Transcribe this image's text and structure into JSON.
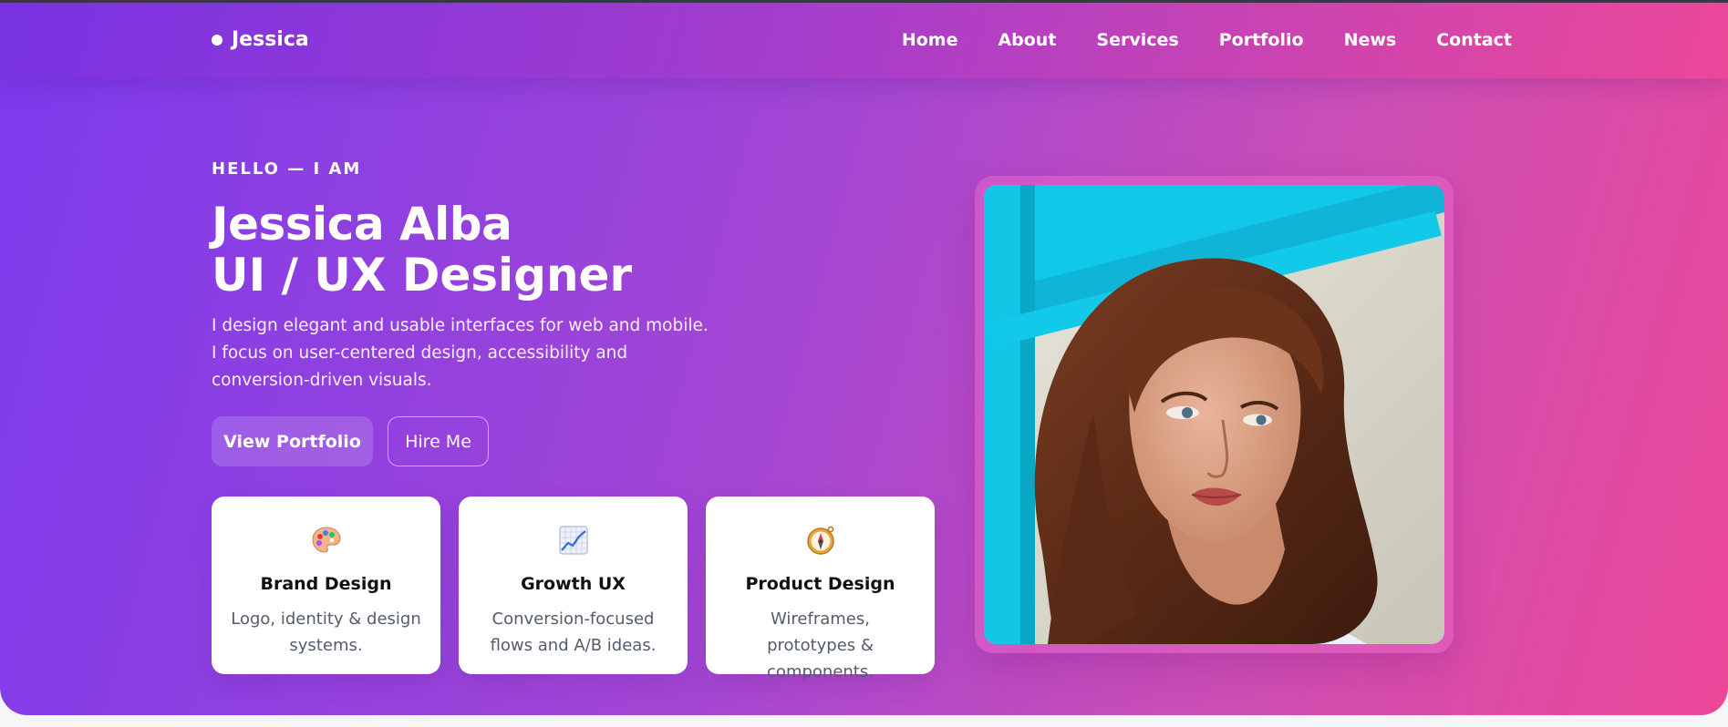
{
  "brand": {
    "name": "Jessica"
  },
  "nav": {
    "items": [
      "Home",
      "About",
      "Services",
      "Portfolio",
      "News",
      "Contact"
    ]
  },
  "hero": {
    "eyebrow": "HELLO — I AM",
    "name": "Jessica Alba",
    "role": "UI / UX Designer",
    "description_lines": [
      "I design elegant and usable interfaces for web and mobile.",
      "I focus on user-centered design, accessibility and",
      "conversion-driven visuals."
    ],
    "primary_button": "View Portfolio",
    "secondary_button": "Hire Me"
  },
  "services": [
    {
      "icon": "palette-icon",
      "title": "Brand Design",
      "text": "Logo, identity & design systems."
    },
    {
      "icon": "chart-increasing-icon",
      "title": "Growth UX",
      "text": "Conversion-focused flows and A/B ideas."
    },
    {
      "icon": "compass-icon",
      "title": "Product Design",
      "text": "Wireframes, prototypes & components."
    }
  ],
  "colors": {
    "gradient_start": "#7c3aed",
    "gradient_end": "#ec4899",
    "accent_cyan": "#10c8e8"
  }
}
